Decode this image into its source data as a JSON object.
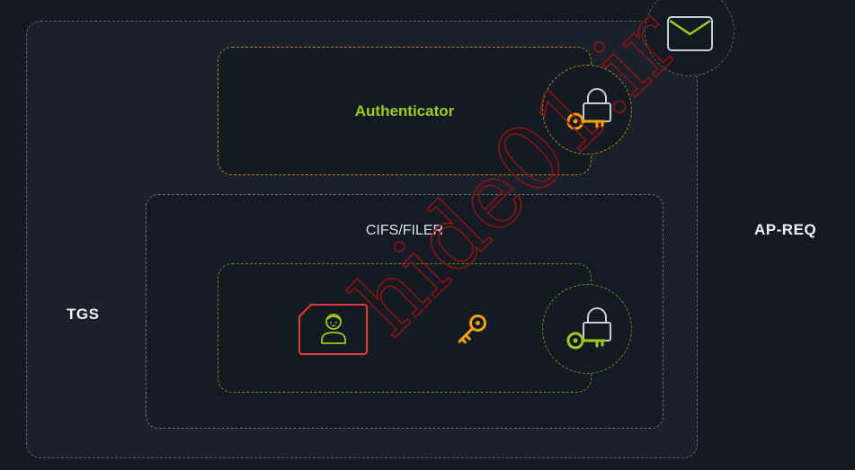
{
  "labels": {
    "authenticator": "Authenticator",
    "service": "CIFS/FILER",
    "tgs": "TGS",
    "ap_req": "AP-REQ"
  },
  "watermark": "hide01.ir",
  "icons": {
    "envelope": "envelope-icon",
    "auth_lock": "lock-key-icon",
    "ticket_lock": "lock-key-icon",
    "user_card": "user-card-icon",
    "session_key": "key-icon"
  },
  "colors": {
    "background": "#141a22",
    "authenticator_accent": "#9ccd1c",
    "orange": "#f4a20c",
    "green": "#9ccd1c",
    "red": "#e63a3a",
    "watermark": "#8b1414"
  }
}
